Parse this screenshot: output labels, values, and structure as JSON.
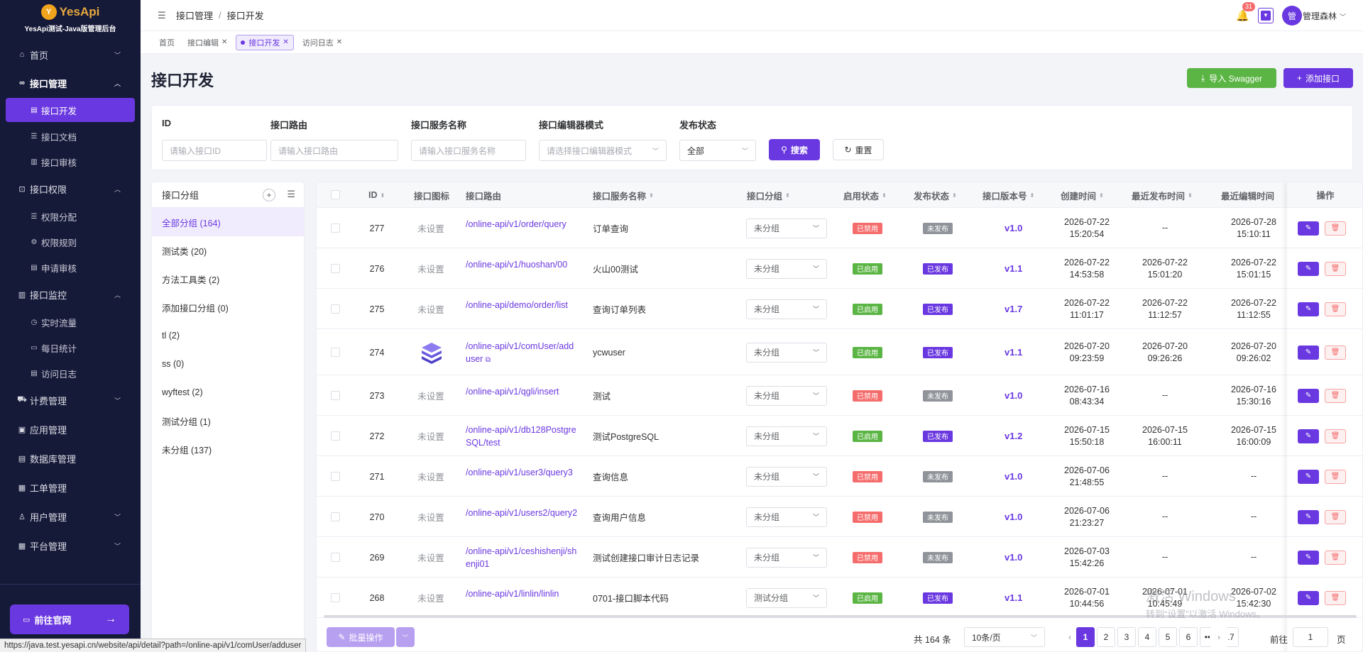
{
  "brand": {
    "logo_glyph": "Y",
    "name": "YesApi",
    "subtitle": "YesApi测试-Java版管理后台"
  },
  "sidebar": {
    "home": "首页",
    "api_mgmt": {
      "label": "接口管理",
      "items": [
        "接口开发",
        "接口文档",
        "接口审核"
      ]
    },
    "api_perm": {
      "label": "接口权限",
      "items": [
        "权限分配",
        "权限规则",
        "申请审核"
      ]
    },
    "api_monitor": {
      "label": "接口监控",
      "items": [
        "实时流量",
        "每日统计",
        "访问日志"
      ]
    },
    "others": [
      "计费管理",
      "应用管理",
      "数据库管理",
      "工单管理",
      "用户管理",
      "平台管理"
    ],
    "website_btn": "前往官网"
  },
  "topbar": {
    "crumb1": "接口管理",
    "crumb_sep": "/",
    "crumb2": "接口开发",
    "bell_count": "31",
    "avatar": "管",
    "user": "管理森林"
  },
  "tabs": [
    "首页",
    "接口编辑",
    "接口开发",
    "访问日志"
  ],
  "page": {
    "title": "接口开发",
    "import_btn": "导入 Swagger",
    "add_btn": "添加接口"
  },
  "filter": {
    "id_label": "ID",
    "id_ph": "请输入接口ID",
    "route_label": "接口路由",
    "route_ph": "请输入接口路由",
    "service_label": "接口服务名称",
    "service_ph": "请输入接口服务名称",
    "editor_label": "接口编辑器模式",
    "editor_ph": "请选择接口编辑器模式",
    "status_label": "发布状态",
    "status_val": "全部",
    "search_btn": "搜索",
    "reset_btn": "重置"
  },
  "groups": {
    "title": "接口分组",
    "items": [
      "全部分组 (164)",
      "测试类 (20)",
      "方法工具类 (2)",
      "添加接口分组 (0)",
      "tl (2)",
      "ss (0)",
      "wyftest (2)",
      "测试分组 (1)",
      "未分组 (137)"
    ]
  },
  "table": {
    "headers": {
      "id": "ID",
      "icon": "接口图标",
      "route": "接口路由",
      "service": "接口服务名称",
      "group": "接口分组",
      "enable": "启用状态",
      "publish": "发布状态",
      "version": "接口版本号",
      "created": "创建时间",
      "published": "最近发布时间",
      "edited": "最近编辑时间",
      "ops": "操作"
    },
    "rows": [
      {
        "id": "277",
        "icon": "未设置",
        "route1": "/online-api/v1/order/query",
        "route2": "",
        "service": "订单查询",
        "group": "未分组",
        "enable": "已禁用",
        "publish": "未发布",
        "version": "v1.0",
        "created1": "2026-07-22",
        "created2": "15:20:54",
        "pub1": "--",
        "pub2": "",
        "edit1": "2026-07-28",
        "edit2": "15:10:11"
      },
      {
        "id": "276",
        "icon": "未设置",
        "route1": "/online-api/v1/huoshan/00",
        "route2": "",
        "service": "火山00测试",
        "group": "未分组",
        "enable": "已启用",
        "publish": "已发布",
        "version": "v1.1",
        "created1": "2026-07-22",
        "created2": "14:53:58",
        "pub1": "2026-07-22",
        "pub2": "15:01:20",
        "edit1": "2026-07-22",
        "edit2": "15:01:15"
      },
      {
        "id": "275",
        "icon": "未设置",
        "route1": "/online-api/demo/order/list",
        "route2": "",
        "service": "查询订单列表",
        "group": "未分组",
        "enable": "已启用",
        "publish": "已发布",
        "version": "v1.7",
        "created1": "2026-07-22",
        "created2": "11:01:17",
        "pub1": "2026-07-22",
        "pub2": "11:12:57",
        "edit1": "2026-07-22",
        "edit2": "11:12:55"
      },
      {
        "id": "274",
        "icon": "",
        "route1": "/online-api/v1/comUser/add",
        "route2": "user",
        "service": "ycwuser",
        "group": "未分组",
        "enable": "已启用",
        "publish": "已发布",
        "version": "v1.1",
        "created1": "2026-07-20",
        "created2": "09:23:59",
        "pub1": "2026-07-20",
        "pub2": "09:26:26",
        "edit1": "2026-07-20",
        "edit2": "09:26:02"
      },
      {
        "id": "273",
        "icon": "未设置",
        "route1": "/online-api/v1/qgli/insert",
        "route2": "",
        "service": "测试",
        "group": "未分组",
        "enable": "已禁用",
        "publish": "未发布",
        "version": "v1.0",
        "created1": "2026-07-16",
        "created2": "08:43:34",
        "pub1": "--",
        "pub2": "",
        "edit1": "2026-07-16",
        "edit2": "15:30:16"
      },
      {
        "id": "272",
        "icon": "未设置",
        "route1": "/online-api/v1/db128Postgre",
        "route2": "SQL/test",
        "service": "测试PostgreSQL",
        "group": "未分组",
        "enable": "已启用",
        "publish": "已发布",
        "version": "v1.2",
        "created1": "2026-07-15",
        "created2": "15:50:18",
        "pub1": "2026-07-15",
        "pub2": "16:00:11",
        "edit1": "2026-07-15",
        "edit2": "16:00:09"
      },
      {
        "id": "271",
        "icon": "未设置",
        "route1": "/online-api/v1/user3/query3",
        "route2": "",
        "service": "查询信息",
        "group": "未分组",
        "enable": "已禁用",
        "publish": "未发布",
        "version": "v1.0",
        "created1": "2026-07-06",
        "created2": "21:48:55",
        "pub1": "--",
        "pub2": "",
        "edit1": "--",
        "edit2": ""
      },
      {
        "id": "270",
        "icon": "未设置",
        "route1": "/online-api/v1/users2/query2",
        "route2": "",
        "service": "查询用户信息",
        "group": "未分组",
        "enable": "已禁用",
        "publish": "未发布",
        "version": "v1.0",
        "created1": "2026-07-06",
        "created2": "21:23:27",
        "pub1": "--",
        "pub2": "",
        "edit1": "--",
        "edit2": ""
      },
      {
        "id": "269",
        "icon": "未设置",
        "route1": "/online-api/v1/ceshishenji/sh",
        "route2": "enji01",
        "service": "测试创建接口审计日志记录",
        "group": "未分组",
        "enable": "已禁用",
        "publish": "未发布",
        "version": "v1.0",
        "created1": "2026-07-03",
        "created2": "15:42:26",
        "pub1": "--",
        "pub2": "",
        "edit1": "--",
        "edit2": ""
      },
      {
        "id": "268",
        "icon": "未设置",
        "route1": "/online-api/v1/linlin/linlin",
        "route2": "",
        "service": "0701-接口脚本代码",
        "group": "测试分组",
        "enable": "已启用",
        "publish": "已发布",
        "version": "v1.1",
        "created1": "2026-07-01",
        "created2": "10:44:56",
        "pub1": "2026-07-01",
        "pub2": "10:45:49",
        "edit1": "2026-07-02",
        "edit2": "15:42:30"
      }
    ]
  },
  "pager": {
    "batch": "批量操作",
    "total": "共 164 条",
    "size": "10条/页",
    "pages": [
      "1",
      "2",
      "3",
      "4",
      "5",
      "6",
      "•••",
      "17"
    ],
    "goto_prefix": "前往",
    "goto_val": "1",
    "goto_suffix": "页"
  },
  "watermark": {
    "line1": "激活 Windows",
    "line2": "转到“设置”以激活 Windows。"
  },
  "status_url": "https://java.test.yesapi.cn/website/api/detail?path=/online-api/v1/comUser/adduser",
  "colors": {
    "accent": "#6a38e0",
    "sidebar_bg": "#161a39",
    "green": "#5bb544",
    "red": "#f56c6c",
    "grey": "#909399"
  }
}
